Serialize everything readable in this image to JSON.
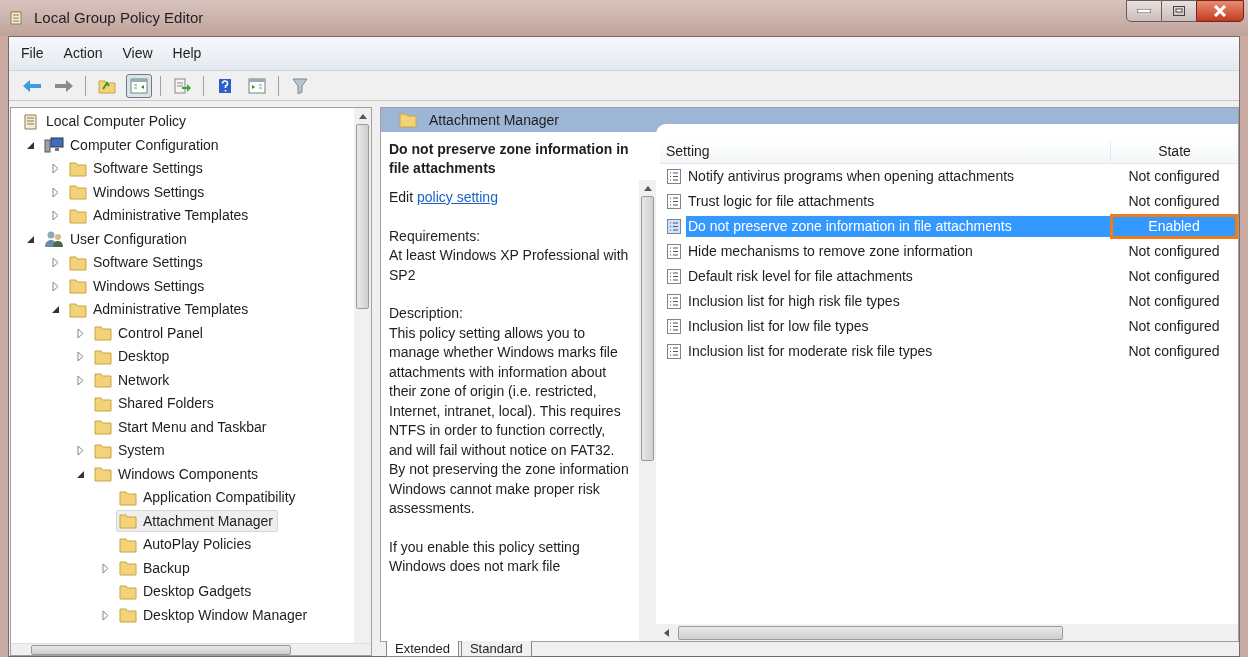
{
  "window": {
    "title": "Local Group Policy Editor"
  },
  "menu": [
    "File",
    "Action",
    "View",
    "Help"
  ],
  "toolbar": [
    {
      "kind": "back",
      "pressed": false
    },
    {
      "kind": "forward",
      "pressed": false
    },
    {
      "kind": "up",
      "pressed": false
    },
    {
      "kind": "tree",
      "pressed": true
    },
    {
      "kind": "export",
      "pressed": false
    },
    {
      "kind": "help",
      "pressed": false
    },
    {
      "kind": "panel",
      "pressed": false
    },
    {
      "kind": "filter",
      "pressed": false
    }
  ],
  "tree": [
    {
      "label": "Local Computer Policy",
      "kind": "policy",
      "selected": false,
      "children": [
        {
          "label": "Computer Configuration",
          "kind": "computer",
          "expanded": true,
          "selected": false,
          "children": [
            {
              "label": "Software Settings",
              "kind": "folder",
              "expanded": false,
              "selected": false
            },
            {
              "label": "Windows Settings",
              "kind": "folder",
              "expanded": false,
              "selected": false
            },
            {
              "label": "Administrative Templates",
              "kind": "folder",
              "expanded": false,
              "selected": false
            }
          ]
        },
        {
          "label": "User Configuration",
          "kind": "user",
          "expanded": true,
          "selected": false,
          "children": [
            {
              "label": "Software Settings",
              "kind": "folder",
              "expanded": false,
              "selected": false
            },
            {
              "label": "Windows Settings",
              "kind": "folder",
              "expanded": false,
              "selected": false
            },
            {
              "label": "Administrative Templates",
              "kind": "folder",
              "expanded": true,
              "selected": false,
              "children": [
                {
                  "label": "Control Panel",
                  "kind": "folder",
                  "expanded": false,
                  "selected": false
                },
                {
                  "label": "Desktop",
                  "kind": "folder",
                  "expanded": false,
                  "selected": false
                },
                {
                  "label": "Network",
                  "kind": "folder",
                  "expanded": false,
                  "selected": false
                },
                {
                  "label": "Shared Folders",
                  "kind": "folder",
                  "selected": false
                },
                {
                  "label": "Start Menu and Taskbar",
                  "kind": "folder",
                  "selected": false
                },
                {
                  "label": "System",
                  "kind": "folder",
                  "expanded": false,
                  "selected": false
                },
                {
                  "label": "Windows Components",
                  "kind": "folder",
                  "expanded": true,
                  "selected": false,
                  "children": [
                    {
                      "label": "Application Compatibility",
                      "kind": "folder",
                      "selected": false
                    },
                    {
                      "label": "Attachment Manager",
                      "kind": "folder",
                      "selected": true
                    },
                    {
                      "label": "AutoPlay Policies",
                      "kind": "folder",
                      "selected": false
                    },
                    {
                      "label": "Backup",
                      "kind": "folder",
                      "expanded": false,
                      "selected": false
                    },
                    {
                      "label": "Desktop Gadgets",
                      "kind": "folder",
                      "selected": false
                    },
                    {
                      "label": "Desktop Window Manager",
                      "kind": "folder",
                      "expanded": false,
                      "selected": false
                    }
                  ]
                }
              ]
            }
          ]
        }
      ]
    }
  ],
  "pane_title": "Attachment Manager",
  "details": {
    "heading": "Do not preserve zone information in file attachments",
    "edit_prefix": "Edit",
    "edit_link": "policy setting",
    "requirements_label": "Requirements:",
    "requirements": "At least Windows XP Professional with SP2",
    "description_label": "Description:",
    "description": "This policy setting allows you to manage whether Windows marks file attachments with information about their zone of origin (i.e. restricted, Internet, intranet, local). This requires NTFS in order to function correctly, and will fail without notice on FAT32. By not preserving the zone information Windows cannot make proper risk assessments.",
    "more": "If you enable this policy setting Windows does not mark file"
  },
  "table": {
    "columns": [
      "Setting",
      "State"
    ],
    "rows": [
      {
        "setting": "Notify antivirus programs when opening attachments",
        "state": "Not configured",
        "selected": false,
        "outlined": false
      },
      {
        "setting": "Trust logic for file attachments",
        "state": "Not configured",
        "selected": false,
        "outlined": false
      },
      {
        "setting": "Do not preserve zone information in file attachments",
        "state": "Enabled",
        "selected": true,
        "outlined": true
      },
      {
        "setting": "Hide mechanisms to remove zone information",
        "state": "Not configured",
        "selected": false,
        "outlined": false
      },
      {
        "setting": "Default risk level for file attachments",
        "state": "Not configured",
        "selected": false,
        "outlined": false
      },
      {
        "setting": "Inclusion list for high risk file types",
        "state": "Not configured",
        "selected": false,
        "outlined": false
      },
      {
        "setting": "Inclusion list for low file types",
        "state": "Not configured",
        "selected": false,
        "outlined": false
      },
      {
        "setting": "Inclusion list for moderate risk file types",
        "state": "Not configured",
        "selected": false,
        "outlined": false
      }
    ]
  },
  "view_tabs": [
    {
      "label": "Extended",
      "selected": true
    },
    {
      "label": "Standard",
      "selected": false
    }
  ]
}
